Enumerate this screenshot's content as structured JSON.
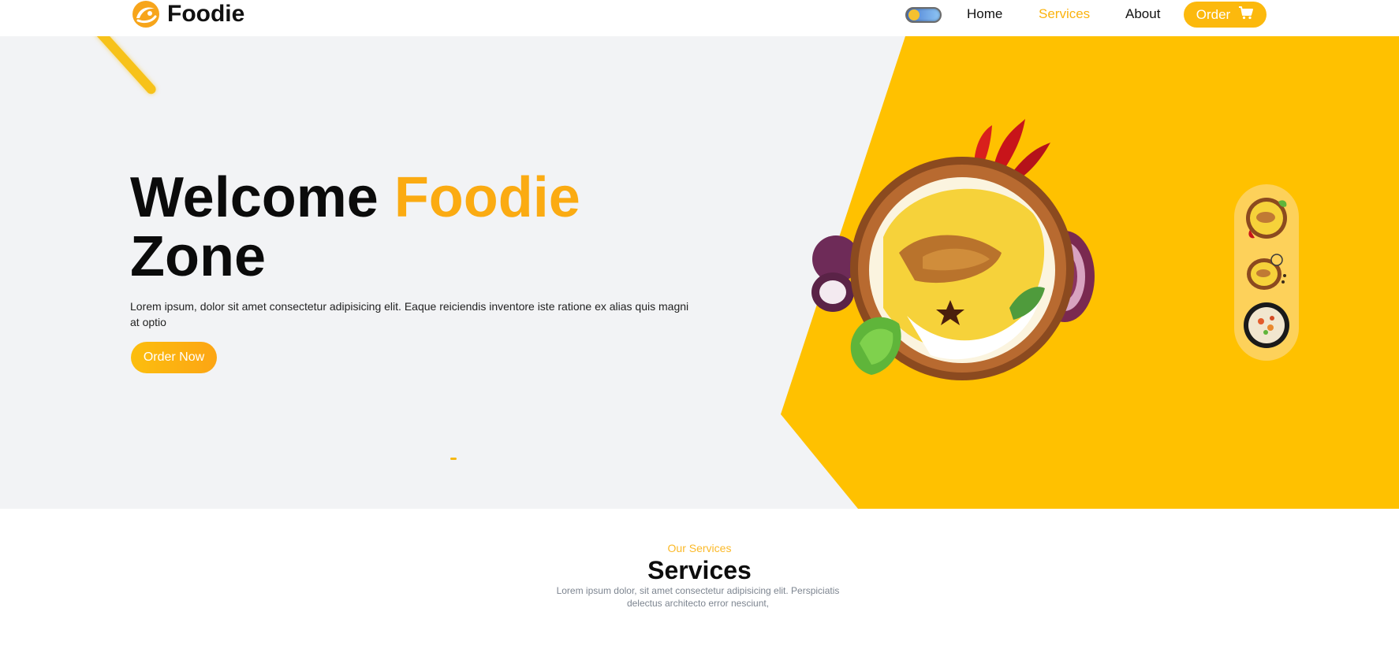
{
  "navbar": {
    "brand": "Foodie",
    "logo_icon": "spoon-fork-logo-icon",
    "toggle_icon": "theme-toggle-icon",
    "links": [
      "Home",
      "Services",
      "About"
    ],
    "active_link": "Services",
    "order_label": "Order",
    "cart_icon": "cart-icon"
  },
  "hero": {
    "title_part1": "Welcome",
    "title_accent": "Foodie",
    "title_part2": "Zone",
    "description": "Lorem ipsum, dolor sit amet consectetur adipisicing elit. Eaque reiciendis inventore iste ratione ex alias quis magni at optio",
    "cta_label": "Order Now",
    "dish_image": "biryani-plate-image",
    "thumbnails": [
      "biryani-thumb-1",
      "biryani-thumb-2",
      "biryani-thumb-3"
    ]
  },
  "services": {
    "kicker": "Our Services",
    "title": "Services",
    "description": "Lorem ipsum dolor, sit amet consectetur adipisicing elit. Perspiciatis delectus architecto error nesciunt,"
  },
  "colors": {
    "accent": "#fbb30f",
    "hero_yellow": "#ffc100",
    "hero_bg": "#f2f3f5",
    "text_dark": "#0b0b0b",
    "muted": "#7d8590"
  }
}
